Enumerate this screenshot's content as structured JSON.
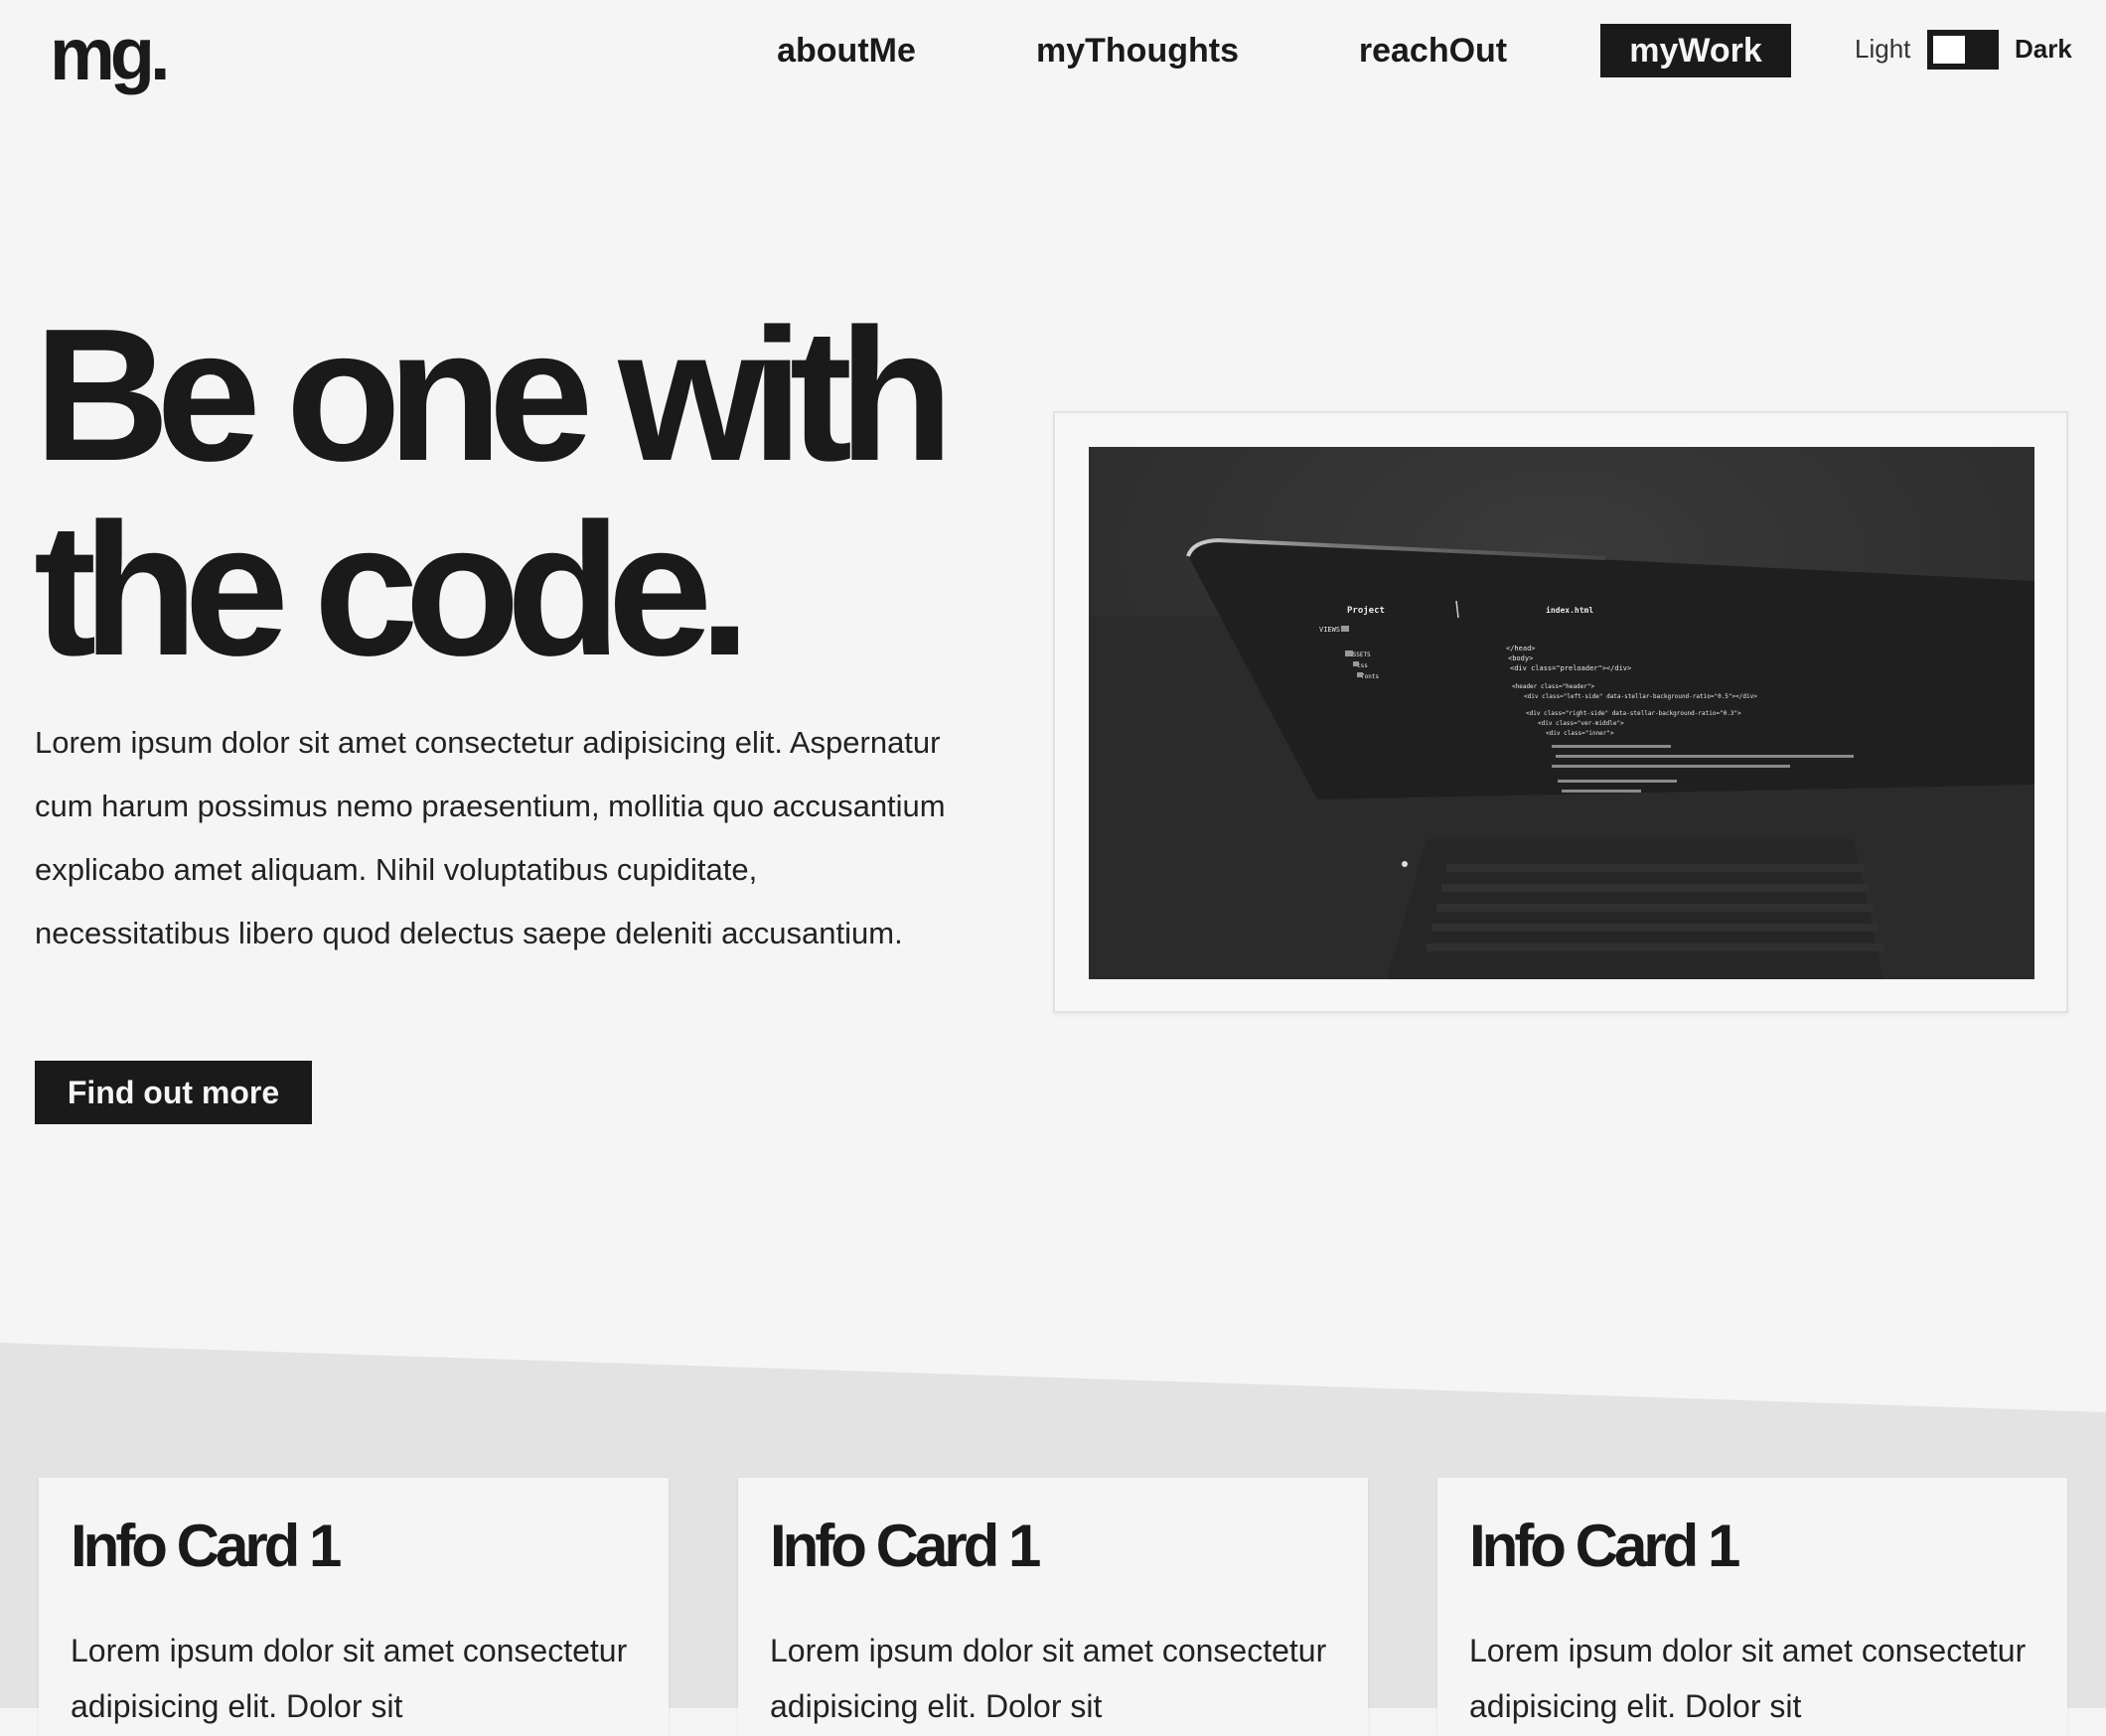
{
  "header": {
    "logo": "mg.",
    "nav": [
      {
        "label": "aboutMe"
      },
      {
        "label": "myThoughts"
      },
      {
        "label": "reachOut"
      },
      {
        "label": "myWork",
        "active": true
      }
    ],
    "theme_toggle": {
      "light_label": "Light",
      "dark_label": "Dark",
      "state": "light"
    }
  },
  "hero": {
    "title_line1": "Be one with",
    "title_line2": "the code.",
    "text": "Lorem ipsum dolor sit amet consectetur adipisicing elit. Aspernatur cum harum possimus nemo praesentium, mollitia quo accusantium explicabo amet aliquam. Nihil voluptatibus cupiditate, necessitatibus libero quod delectus saepe deleniti accusantium.",
    "button_label": "Find out more",
    "image": {
      "sidebar_title": "Project",
      "sidebar_items": [
        "VIEWS",
        "ASSETS",
        "css",
        "fonts"
      ],
      "file_title": "index.html",
      "code_lines": [
        "</head>",
        "<body>",
        "<div class=\"preloader\"></div>",
        "<header class=\"header\">",
        "<div class=\"left-side\" data-stellar-background-ratio=\"0.5\"></div>",
        "<div class=\"right-side\" data-stellar-background-ratio=\"0.3\">",
        "<div class=\"ver-middle\">",
        "<div class=\"inner\">"
      ]
    }
  },
  "cards": [
    {
      "title": "Info Card 1",
      "text": "Lorem ipsum dolor sit amet consectetur adipisicing elit. Dolor sit"
    },
    {
      "title": "Info Card 1",
      "text": "Lorem ipsum dolor sit amet consectetur adipisicing elit. Dolor sit"
    },
    {
      "title": "Info Card 1",
      "text": "Lorem ipsum dolor sit amet consectetur adipisicing elit. Dolor sit"
    }
  ],
  "colors": {
    "background": "#f5f5f5",
    "text": "#1a1a1a",
    "band": "#e3e3e3",
    "accent": "#1a1a1a"
  }
}
